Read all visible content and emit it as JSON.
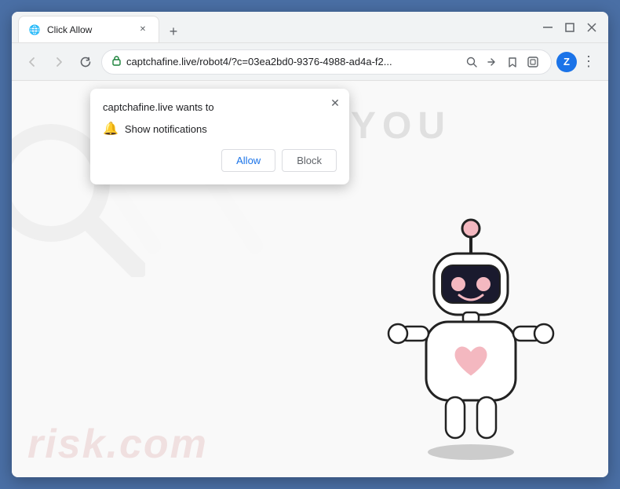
{
  "browser": {
    "title": "Click Allow",
    "tab": {
      "title": "Click Allow",
      "favicon": "🌐"
    },
    "controls": {
      "minimize": "—",
      "maximize": "☐",
      "close": "✕",
      "collapse": "⌄",
      "new_tab": "+"
    },
    "address_bar": {
      "url": "captchafine.live/robot4/?c=03ea2bd0-9376-4988-ad4a-f2...",
      "back_title": "back",
      "forward_title": "forward",
      "reload_title": "reload",
      "profile_letter": "Z"
    }
  },
  "notification_popup": {
    "title": "captchafine.live wants to",
    "permission_label": "Show notifications",
    "allow_btn": "Allow",
    "block_btn": "Block",
    "close_label": "✕"
  },
  "page": {
    "you_text": "YOU",
    "watermark_main": "risk",
    "watermark_sub": "risk.com",
    "robot_shadow": true
  }
}
